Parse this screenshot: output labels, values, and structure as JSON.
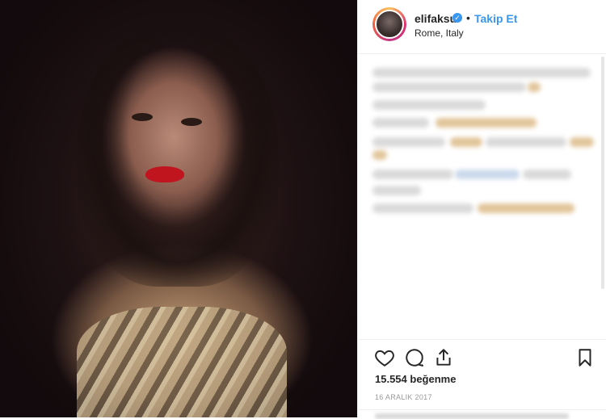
{
  "post": {
    "photo_alt": "post-photo"
  },
  "header": {
    "username": "elifaksu",
    "separator": "•",
    "follow_label": "Takip Et",
    "location": "Rome, Italy"
  },
  "actions": {
    "like_icon": "heart-icon",
    "comment_icon": "comment-icon",
    "share_icon": "share-icon",
    "save_icon": "bookmark-icon"
  },
  "stats": {
    "likes": "15.554 beğenme",
    "date": "16 ARALIK 2017"
  },
  "colors": {
    "accent": "#3897f0",
    "text": "#262626",
    "muted": "#999999"
  }
}
